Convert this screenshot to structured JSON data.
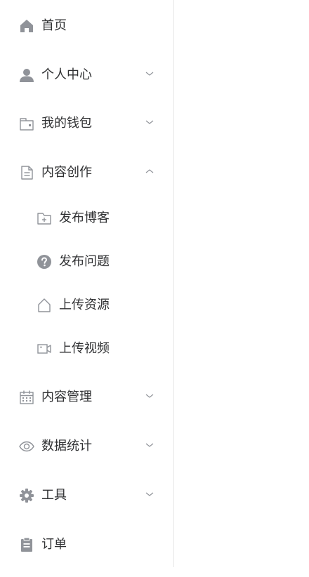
{
  "menu": {
    "home": {
      "label": "首页",
      "icon": "home-icon"
    },
    "personal": {
      "label": "个人中心",
      "icon": "user-icon",
      "expanded": false
    },
    "wallet": {
      "label": "我的钱包",
      "icon": "wallet-icon",
      "expanded": false
    },
    "create": {
      "label": "内容创作",
      "icon": "document-icon",
      "expanded": true,
      "children": [
        {
          "label": "发布博客",
          "icon": "folder-add-icon"
        },
        {
          "label": "发布问题",
          "icon": "question-icon"
        },
        {
          "label": "上传资源",
          "icon": "house-outline-icon"
        },
        {
          "label": "上传视频",
          "icon": "video-camera-icon"
        }
      ]
    },
    "manage": {
      "label": "内容管理",
      "icon": "calendar-icon",
      "expanded": false
    },
    "stats": {
      "label": "数据统计",
      "icon": "eye-icon",
      "expanded": false
    },
    "tools": {
      "label": "工具",
      "icon": "gear-icon",
      "expanded": false
    },
    "orders": {
      "label": "订单",
      "icon": "clipboard-icon"
    }
  },
  "colors": {
    "icon": "#909399",
    "text": "#303133",
    "chevron": "#909399",
    "divider": "#e6e6e6"
  }
}
